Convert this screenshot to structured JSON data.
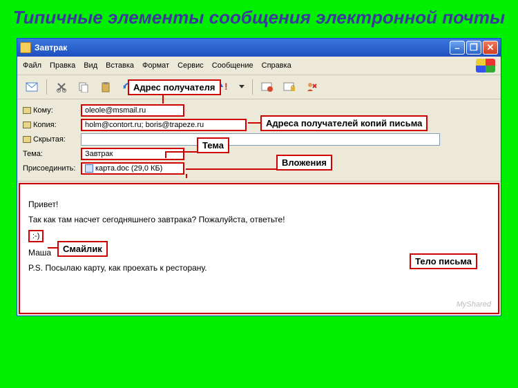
{
  "slide_title": "Типичные элементы сообщения электронной почты",
  "window": {
    "title": "Завтрак"
  },
  "menu": {
    "file": "Файл",
    "edit": "Правка",
    "view": "Вид",
    "insert": "Вставка",
    "format": "Формат",
    "tools": "Сервис",
    "message": "Сообщение",
    "help": "Справка"
  },
  "fields": {
    "to_label": "Кому:",
    "to_value": "oleole@msmail.ru",
    "cc_label": "Копия:",
    "cc_value": "holm@contort.ru; boris@trapeze.ru",
    "bcc_label": "Скрытая:",
    "bcc_value": "",
    "subject_label": "Тема:",
    "subject_value": "Завтрак",
    "attach_label": "Присоединить:",
    "attach_value": "карта.doc (29,0 КБ)"
  },
  "body": {
    "line1": "Привет!",
    "line2": "Так как там насчет сегодняшнего завтрака? Пожалуйста, ответьте!",
    "smiley": ":-)",
    "line3": "Маша",
    "line4": "P.S. Посылаю карту, как проехать к ресторану."
  },
  "callouts": {
    "recipient": "Адрес получателя",
    "cc": "Адреса получателей копий письма",
    "subject": "Тема",
    "attachments": "Вложения",
    "smiley": "Смайлик",
    "body": "Тело письма"
  },
  "watermark": "MyShared"
}
